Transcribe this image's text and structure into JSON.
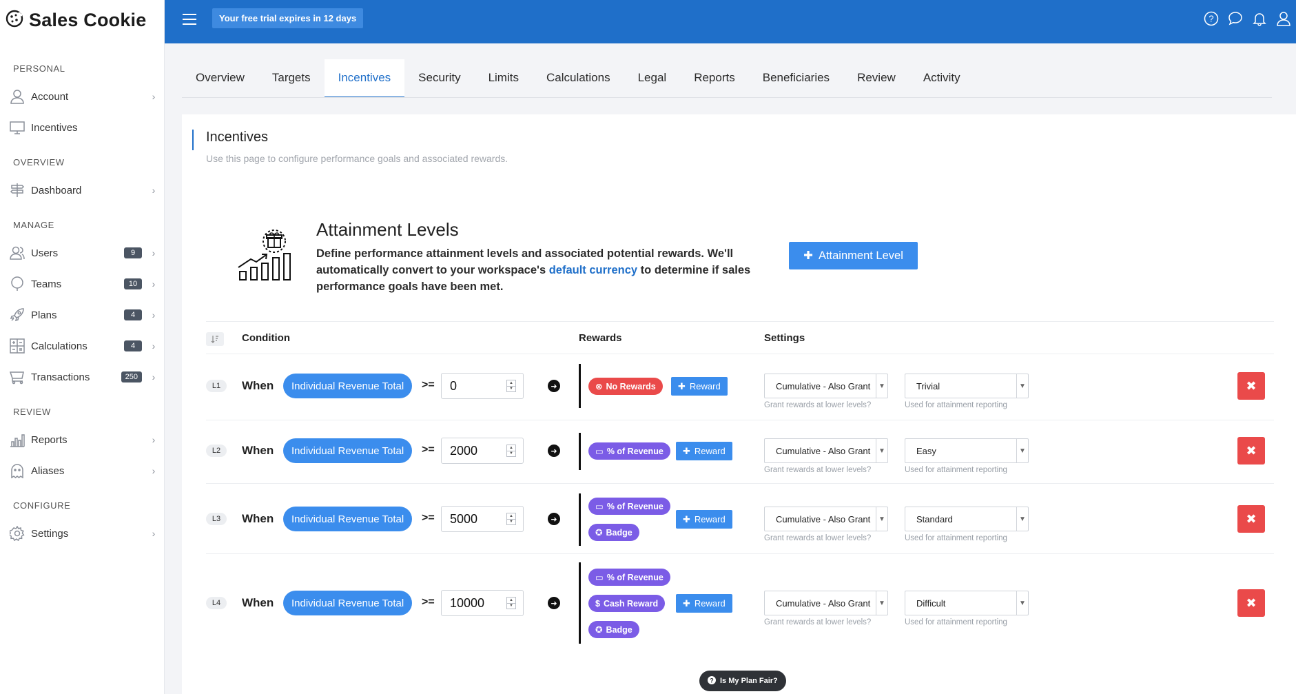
{
  "brand": {
    "name": "Sales Cookie"
  },
  "topbar": {
    "trial": "Your free trial expires in 12 days"
  },
  "sidebar": {
    "sections": {
      "personal": "PERSONAL",
      "overview": "OVERVIEW",
      "manage": "MANAGE",
      "review": "REVIEW",
      "configure": "CONFIGURE"
    },
    "items": {
      "account": {
        "label": "Account"
      },
      "incentives": {
        "label": "Incentives"
      },
      "dashboard": {
        "label": "Dashboard"
      },
      "users": {
        "label": "Users",
        "badge": "9"
      },
      "teams": {
        "label": "Teams",
        "badge": "10"
      },
      "plans": {
        "label": "Plans",
        "badge": "4"
      },
      "calculations": {
        "label": "Calculations",
        "badge": "4"
      },
      "transactions": {
        "label": "Transactions",
        "badge": "250"
      },
      "reports": {
        "label": "Reports"
      },
      "aliases": {
        "label": "Aliases"
      },
      "settings": {
        "label": "Settings"
      }
    }
  },
  "tabs": [
    "Overview",
    "Targets",
    "Incentives",
    "Security",
    "Limits",
    "Calculations",
    "Legal",
    "Reports",
    "Beneficiaries",
    "Review",
    "Activity"
  ],
  "active_tab": "Incentives",
  "page": {
    "title": "Incentives",
    "subtitle": "Use this page to configure performance goals and associated rewards."
  },
  "attainment": {
    "title": "Attainment Levels",
    "desc_1": "Define performance attainment levels and associated potential rewards. We'll automatically convert to your workspace's ",
    "desc_link": "default currency",
    "desc_2": " to determine if sales performance goals have been met.",
    "button": "Attainment Level"
  },
  "table": {
    "headers": {
      "condition": "Condition",
      "rewards": "Rewards",
      "settings": "Settings"
    },
    "when": "When",
    "metric": "Individual Revenue Total",
    "operator": ">=",
    "reward_button": "Reward",
    "hint_cumulative": "Grant rewards at lower levels?",
    "hint_difficulty": "Used for attainment reporting",
    "rows": [
      {
        "level": "L1",
        "value": "0",
        "rewards": [
          "No Rewards"
        ],
        "cumulative": "Cumulative - Also Grant",
        "difficulty": "Trivial"
      },
      {
        "level": "L2",
        "value": "2000",
        "rewards": [
          "% of Revenue"
        ],
        "cumulative": "Cumulative - Also Grant",
        "difficulty": "Easy"
      },
      {
        "level": "L3",
        "value": "5000",
        "rewards": [
          "% of Revenue",
          "Badge"
        ],
        "cumulative": "Cumulative - Also Grant",
        "difficulty": "Standard"
      },
      {
        "level": "L4",
        "value": "10000",
        "rewards": [
          "% of Revenue",
          "Cash Reward",
          "Badge"
        ],
        "cumulative": "Cumulative - Also Grant",
        "difficulty": "Difficult"
      }
    ]
  },
  "fair_button": "Is My Plan Fair?",
  "colors": {
    "primary": "#1f6fc9",
    "button": "#3b8ded",
    "danger": "#ea4a4a",
    "purple": "#7b5ce6"
  }
}
